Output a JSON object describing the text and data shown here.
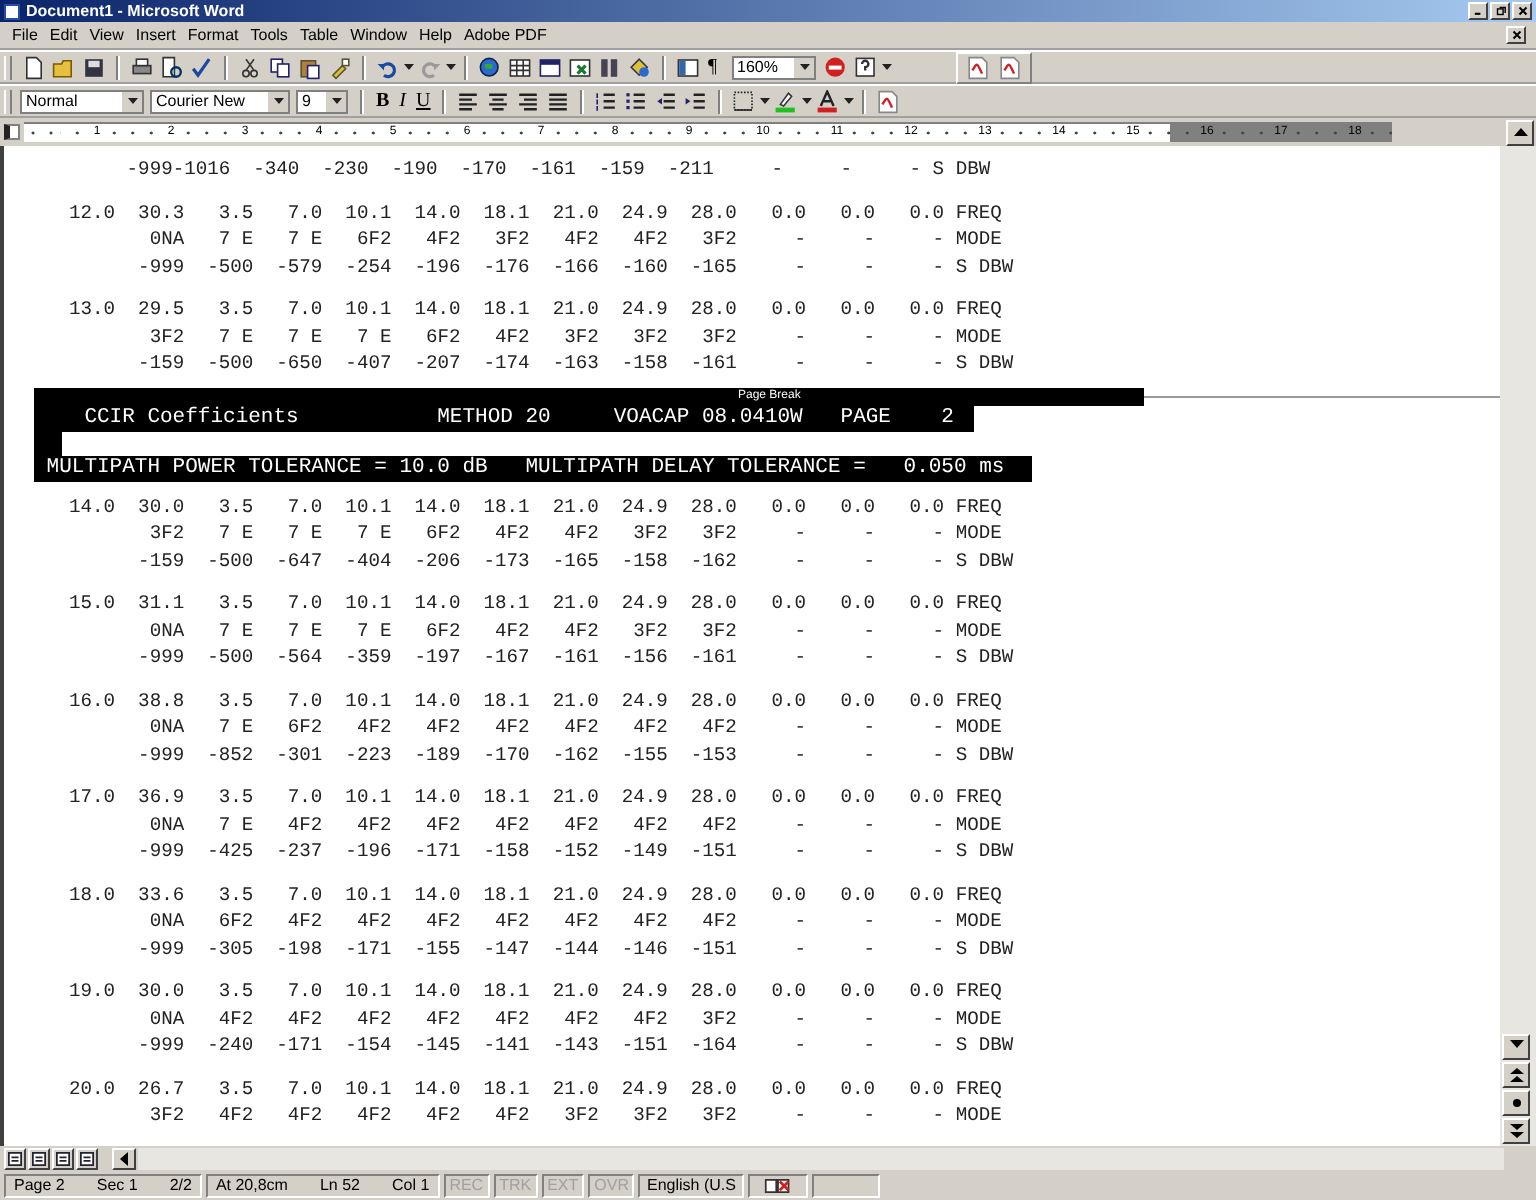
{
  "window": {
    "title": "Document1 - Microsoft Word"
  },
  "menu": [
    "File",
    "Edit",
    "View",
    "Insert",
    "Format",
    "Tools",
    "Table",
    "Window",
    "Help",
    "Adobe PDF"
  ],
  "standard_toolbar": {
    "pilcrow": "¶",
    "zoom": "160%"
  },
  "formatting_toolbar": {
    "style": "Normal",
    "font": "Courier New",
    "size": "9",
    "bold": "B",
    "italic": "I",
    "underline": "U"
  },
  "ruler": {
    "labels": [
      {
        "label": "1",
        "in_margin": false
      },
      {
        "label": "2",
        "in_margin": false
      },
      {
        "label": "3",
        "in_margin": false
      },
      {
        "label": "4",
        "in_margin": false
      },
      {
        "label": "5",
        "in_margin": false
      },
      {
        "label": "6",
        "in_margin": false
      },
      {
        "label": "7",
        "in_margin": false
      },
      {
        "label": "8",
        "in_margin": false
      },
      {
        "label": "9",
        "in_margin": false
      },
      {
        "label": "10",
        "in_margin": false
      },
      {
        "label": "11",
        "in_margin": false
      },
      {
        "label": "12",
        "in_margin": false
      },
      {
        "label": "13",
        "in_margin": false
      },
      {
        "label": "14",
        "in_margin": false
      },
      {
        "label": "15",
        "in_margin": false
      },
      {
        "label": "16",
        "in_margin": true
      },
      {
        "label": "17",
        "in_margin": true
      },
      {
        "label": "18",
        "in_margin": true
      }
    ]
  },
  "document": {
    "blocks_before": [
      {
        "lines": [
          "       -999-1016  -340  -230  -190  -170  -161  -159  -211     -     -     - S DBW"
        ]
      },
      {
        "lines": [
          "  12.0  30.3   3.5   7.0  10.1  14.0  18.1  21.0  24.9  28.0   0.0   0.0   0.0 FREQ",
          "         0NA   7 E   7 E   6F2   4F2   3F2   4F2   4F2   3F2     -     -     - MODE",
          "        -999  -500  -579  -254  -196  -176  -166  -160  -165     -     -     - S DBW"
        ]
      },
      {
        "lines": [
          "  13.0  29.5   3.5   7.0  10.1  14.0  18.1  21.0  24.9  28.0   0.0   0.0   0.0 FREQ",
          "         3F2   7 E   7 E   7 E   6F2   4F2   3F2   3F2   3F2     -     -     - MODE",
          "        -159  -500  -650  -407  -207  -174  -163  -158  -161     -     -     - S DBW"
        ]
      }
    ],
    "page_break": {
      "label": "Page Break",
      "header": "    CCIR Coefficients           METHOD 20     VOACAP 08.0410W   PAGE    2 ",
      "tolerance": " MULTIPATH POWER TOLERANCE = 10.0 dB   MULTIPATH DELAY TOLERANCE =   0.050 ms"
    },
    "blocks_after": [
      {
        "lines": [
          "  14.0  30.0   3.5   7.0  10.1  14.0  18.1  21.0  24.9  28.0   0.0   0.0   0.0 FREQ",
          "         3F2   7 E   7 E   7 E   6F2   4F2   4F2   3F2   3F2     -     -     - MODE",
          "        -159  -500  -647  -404  -206  -173  -165  -158  -162     -     -     - S DBW"
        ]
      },
      {
        "lines": [
          "  15.0  31.1   3.5   7.0  10.1  14.0  18.1  21.0  24.9  28.0   0.0   0.0   0.0 FREQ",
          "         0NA   7 E   7 E   7 E   6F2   4F2   4F2   3F2   3F2     -     -     - MODE",
          "        -999  -500  -564  -359  -197  -167  -161  -156  -161     -     -     - S DBW"
        ]
      },
      {
        "lines": [
          "  16.0  38.8   3.5   7.0  10.1  14.0  18.1  21.0  24.9  28.0   0.0   0.0   0.0 FREQ",
          "         0NA   7 E   6F2   4F2   4F2   4F2   4F2   4F2   4F2     -     -     - MODE",
          "        -999  -852  -301  -223  -189  -170  -162  -155  -153     -     -     - S DBW"
        ]
      },
      {
        "lines": [
          "  17.0  36.9   3.5   7.0  10.1  14.0  18.1  21.0  24.9  28.0   0.0   0.0   0.0 FREQ",
          "         0NA   7 E   4F2   4F2   4F2   4F2   4F2   4F2   4F2     -     -     - MODE",
          "        -999  -425  -237  -196  -171  -158  -152  -149  -151     -     -     - S DBW"
        ]
      },
      {
        "lines": [
          "  18.0  33.6   3.5   7.0  10.1  14.0  18.1  21.0  24.9  28.0   0.0   0.0   0.0 FREQ",
          "         0NA   6F2   4F2   4F2   4F2   4F2   4F2   4F2   4F2     -     -     - MODE",
          "        -999  -305  -198  -171  -155  -147  -144  -146  -151     -     -     - S DBW"
        ]
      },
      {
        "lines": [
          "  19.0  30.0   3.5   7.0  10.1  14.0  18.1  21.0  24.9  28.0   0.0   0.0   0.0 FREQ",
          "         0NA   4F2   4F2   4F2   4F2   4F2   4F2   4F2   3F2     -     -     - MODE",
          "        -999  -240  -171  -154  -145  -141  -143  -151  -164     -     -     - S DBW"
        ]
      },
      {
        "lines": [
          "  20.0  26.7   3.5   7.0  10.1  14.0  18.1  21.0  24.9  28.0   0.0   0.0   0.0 FREQ",
          "         3F2   4F2   4F2   4F2   4F2   4F2   3F2   3F2   3F2     -     -     - MODE"
        ]
      }
    ]
  },
  "status_bar": {
    "groups": [
      [
        "Page 2",
        "Sec 1",
        "2/2"
      ],
      [
        "At 20,8cm",
        "Ln 52",
        "Col 1"
      ]
    ],
    "modes": [
      {
        "label": "REC",
        "on": false
      },
      {
        "label": "TRK",
        "on": false
      },
      {
        "label": "EXT",
        "on": false
      },
      {
        "label": "OVR",
        "on": false
      }
    ],
    "language": "English (U.S"
  }
}
